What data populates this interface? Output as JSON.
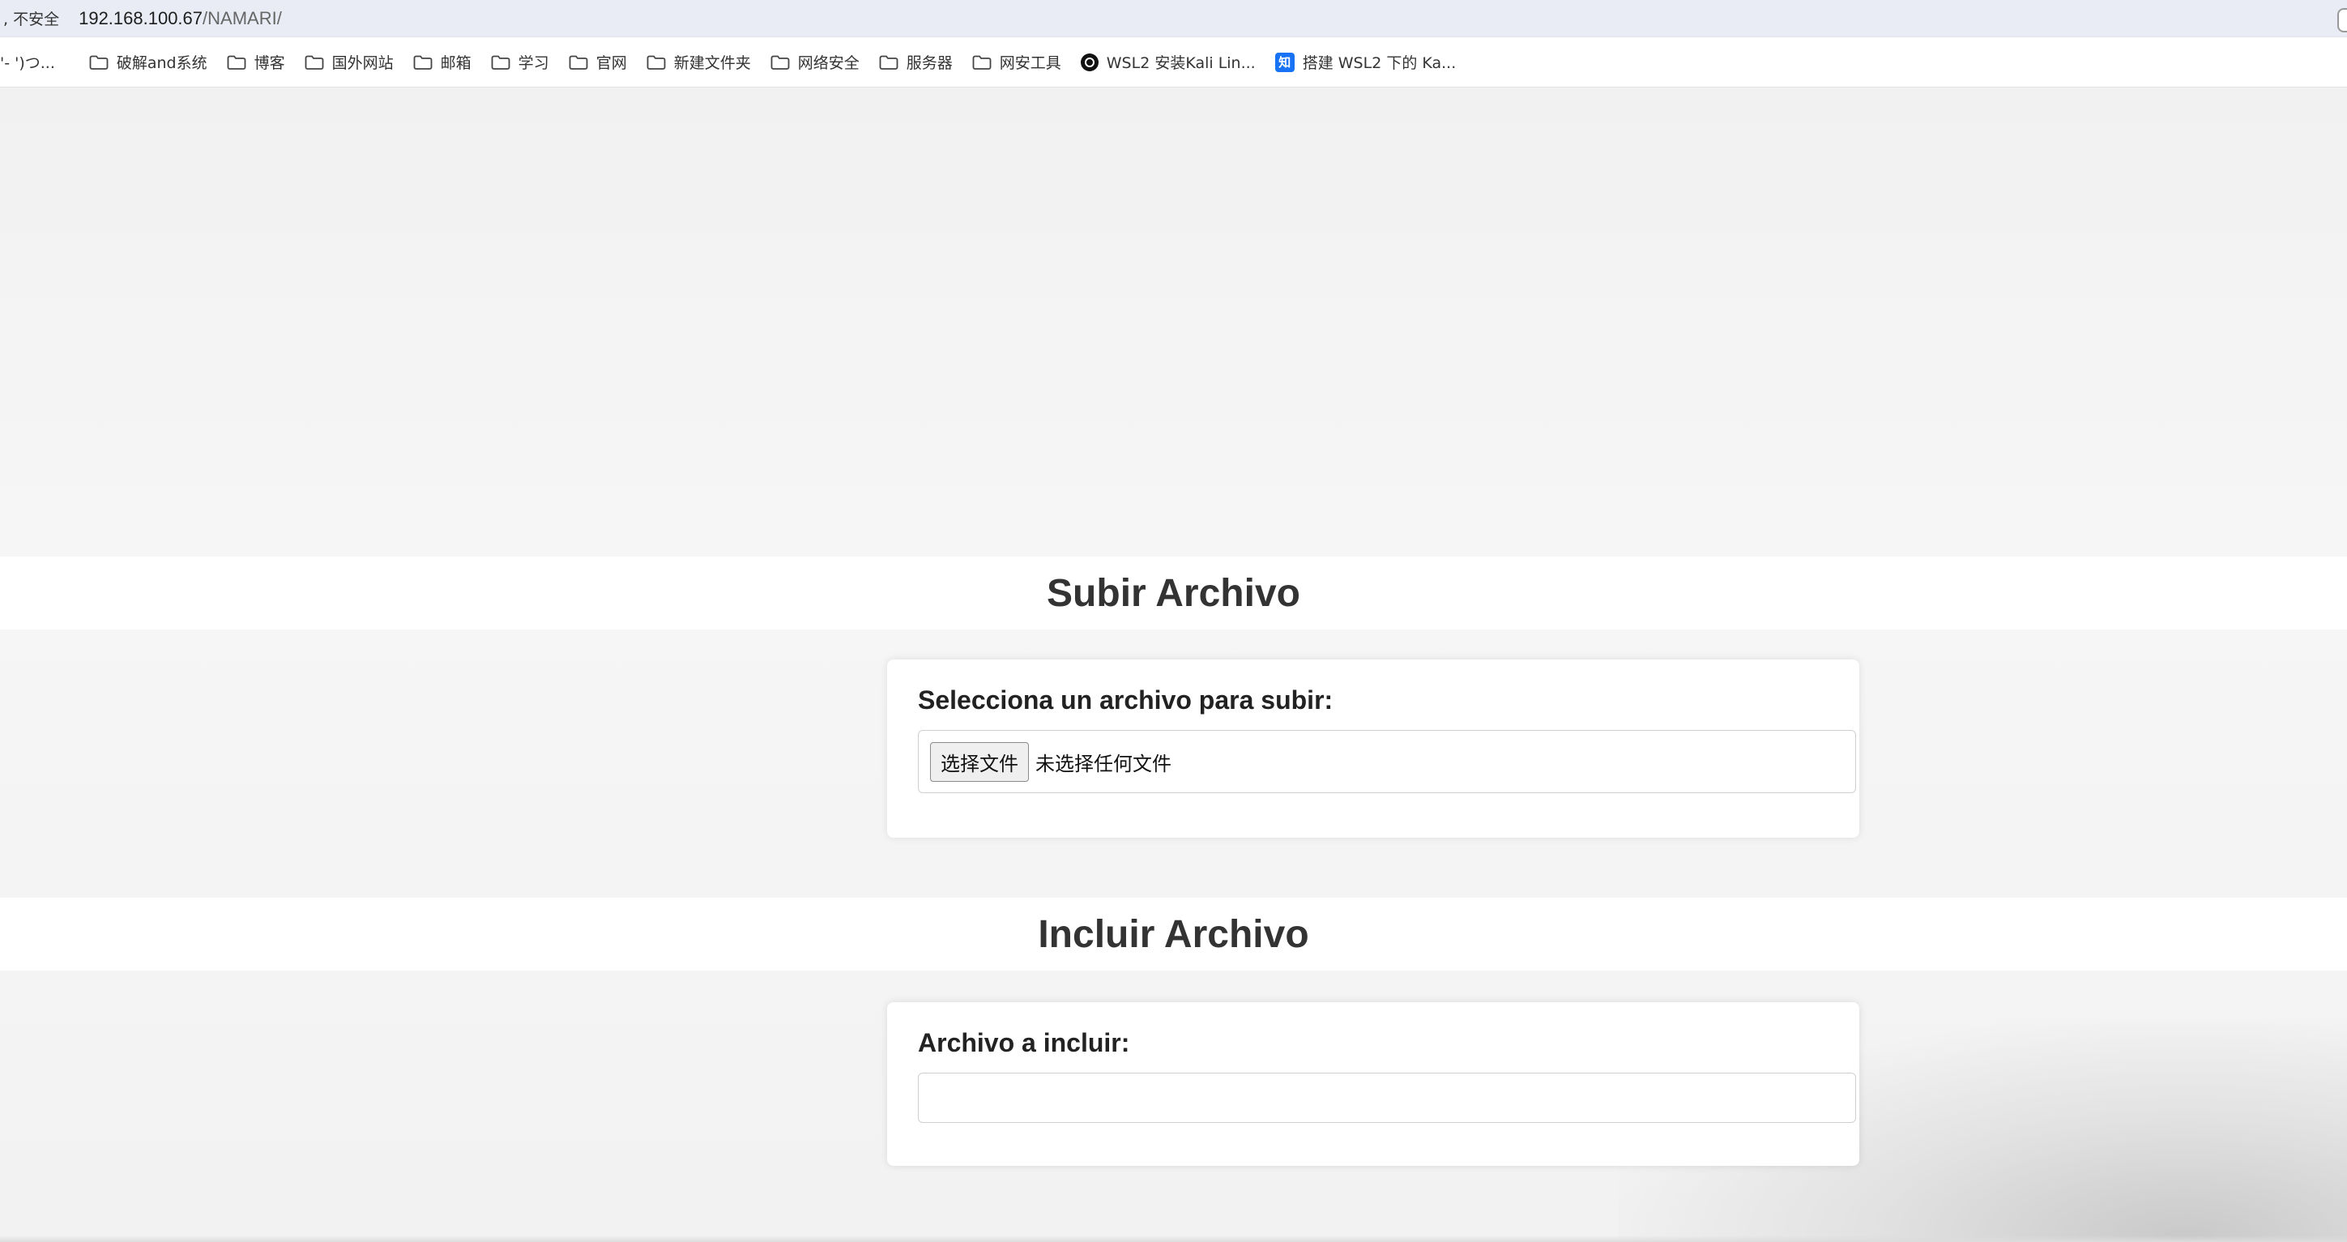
{
  "browser": {
    "security_label": ", 不安全",
    "url_host": "192.168.100.67",
    "url_path": "/NAMARI/"
  },
  "bookmarks": [
    {
      "label": "'- ')つ...",
      "icon": "none"
    },
    {
      "label": "破解and系统",
      "icon": "folder-icon"
    },
    {
      "label": "博客",
      "icon": "folder-icon"
    },
    {
      "label": "国外网站",
      "icon": "folder-icon"
    },
    {
      "label": "邮箱",
      "icon": "folder-icon"
    },
    {
      "label": "学习",
      "icon": "folder-icon"
    },
    {
      "label": "官网",
      "icon": "folder-icon"
    },
    {
      "label": "新建文件夹",
      "icon": "folder-icon"
    },
    {
      "label": "网络安全",
      "icon": "folder-icon"
    },
    {
      "label": "服务器",
      "icon": "folder-icon"
    },
    {
      "label": "网安工具",
      "icon": "folder-icon"
    },
    {
      "label": "WSL2 安装Kali Lin...",
      "icon": "chatgpt-icon"
    },
    {
      "label": "搭建 WSL2 下的 Ka...",
      "icon": "zhihu-icon",
      "icon_text": "知"
    }
  ],
  "upload": {
    "title": "Subir Archivo",
    "label": "Selecciona un archivo para subir:",
    "button": "选择文件",
    "status": "未选择任何文件"
  },
  "include": {
    "title": "Incluir Archivo",
    "label": "Archivo a incluir:",
    "value": ""
  }
}
